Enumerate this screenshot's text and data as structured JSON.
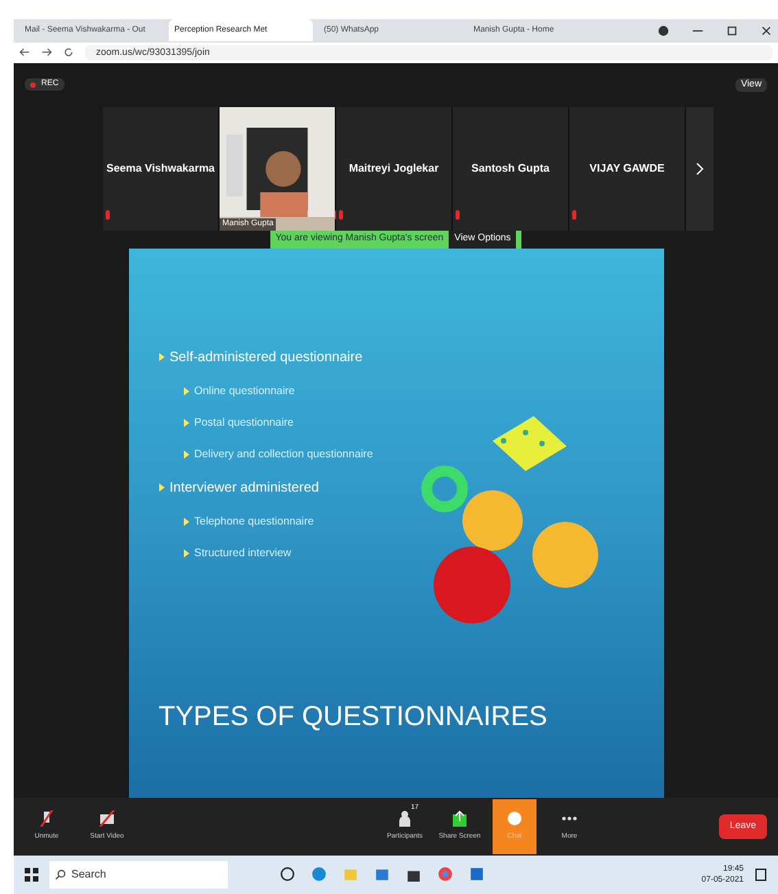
{
  "browser": {
    "tabs": [
      {
        "title": "Mail - Seema Vishwakarma - Out",
        "selected": false
      },
      {
        "title": "Perception Research Met",
        "selected": true
      },
      {
        "title": "(50) WhatsApp",
        "selected": false
      },
      {
        "title": "Manish Gupta - Home",
        "selected": false
      }
    ],
    "url": "zoom.us/wc/93031395/join"
  },
  "meeting": {
    "recording": "REC",
    "view": "View",
    "participants": [
      {
        "name": "Seema Vishwakarma",
        "kind": "name",
        "muted": true
      },
      {
        "name": "Manish Gupta",
        "kind": "video",
        "muted": true
      },
      {
        "name": "Maitreyi Joglekar",
        "kind": "name",
        "muted": true
      },
      {
        "name": "Santosh Gupta",
        "kind": "name",
        "muted": true
      },
      {
        "name": "VIJAY GAWDE",
        "kind": "name",
        "muted": true
      }
    ],
    "banner": "You are viewing Manish Gupta's screen",
    "view_options": "View Options"
  },
  "slide": {
    "bullets": [
      {
        "text": "Self-administered questionnaire",
        "children": [
          {
            "text": "Online questionnaire"
          },
          {
            "text": "Postal questionnaire"
          },
          {
            "text": "Delivery and collection questionnaire"
          }
        ]
      },
      {
        "text": "Interviewer administered",
        "children": [
          {
            "text": "Telephone questionnaire"
          },
          {
            "text": "Structured interview"
          }
        ]
      }
    ],
    "title": "TYPES OF QUESTIONNAIRES"
  },
  "toolbar": {
    "left": [
      {
        "label": "Unmute",
        "kind": "mic"
      },
      {
        "label": "Start Video",
        "kind": "video"
      }
    ],
    "center": [
      {
        "label": "Participants",
        "kind": "participants",
        "count": "17",
        "selected": false
      },
      {
        "label": "Share Screen",
        "kind": "share",
        "selected": false
      },
      {
        "label": "Chat",
        "kind": "chat",
        "selected": true
      },
      {
        "label": "More",
        "kind": "more",
        "selected": false
      }
    ],
    "leave": "Leave"
  },
  "taskbar": {
    "search": "Search",
    "time": "19:45",
    "date": "07-05-2021"
  }
}
